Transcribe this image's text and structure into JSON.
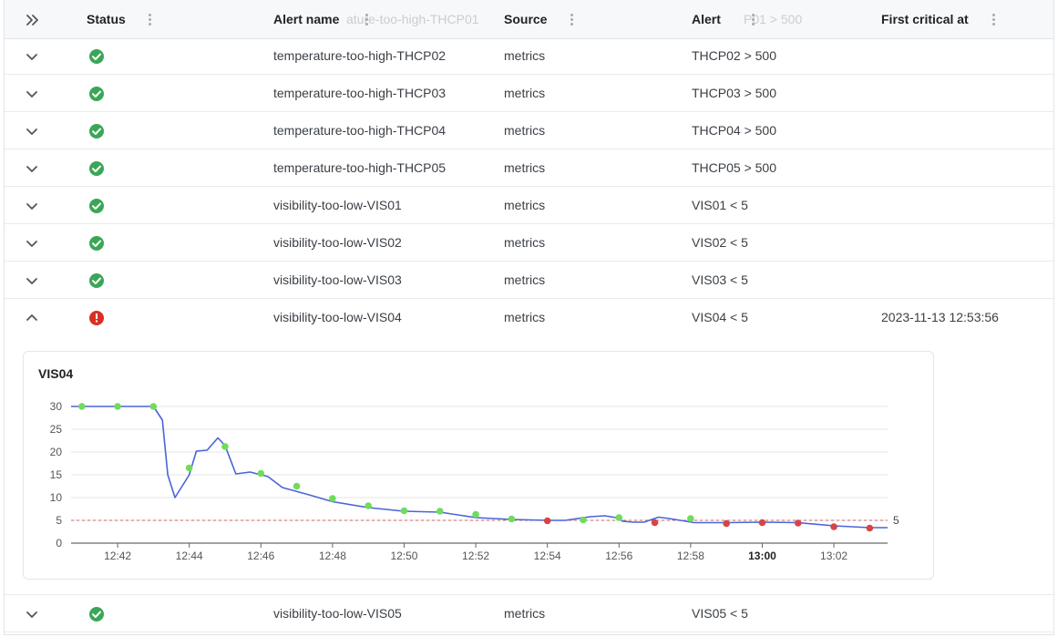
{
  "columns": {
    "status": "Status",
    "alert_name": "Alert name",
    "source": "Source",
    "alert": "Alert",
    "first_critical_at": "First critical at"
  },
  "ghost_header": {
    "alert_name": "ature-too-high-THCP01",
    "alert": "P01 > 500"
  },
  "rows": [
    {
      "name": "temperature-too-high-THCP02",
      "source": "metrics",
      "alert": "THCP02 > 500",
      "status": "ok",
      "first_critical": "",
      "expanded": false
    },
    {
      "name": "temperature-too-high-THCP03",
      "source": "metrics",
      "alert": "THCP03 > 500",
      "status": "ok",
      "first_critical": "",
      "expanded": false
    },
    {
      "name": "temperature-too-high-THCP04",
      "source": "metrics",
      "alert": "THCP04 > 500",
      "status": "ok",
      "first_critical": "",
      "expanded": false
    },
    {
      "name": "temperature-too-high-THCP05",
      "source": "metrics",
      "alert": "THCP05 > 500",
      "status": "ok",
      "first_critical": "",
      "expanded": false
    },
    {
      "name": "visibility-too-low-VIS01",
      "source": "metrics",
      "alert": "VIS01 < 5",
      "status": "ok",
      "first_critical": "",
      "expanded": false
    },
    {
      "name": "visibility-too-low-VIS02",
      "source": "metrics",
      "alert": "VIS02 < 5",
      "status": "ok",
      "first_critical": "",
      "expanded": false
    },
    {
      "name": "visibility-too-low-VIS03",
      "source": "metrics",
      "alert": "VIS03 < 5",
      "status": "ok",
      "first_critical": "",
      "expanded": false
    },
    {
      "name": "visibility-too-low-VIS04",
      "source": "metrics",
      "alert": "VIS04 < 5",
      "status": "critical",
      "first_critical": "2023-11-13 12:53:56",
      "expanded": true
    },
    {
      "name": "visibility-too-low-VIS05",
      "source": "metrics",
      "alert": "VIS05 < 5",
      "status": "ok",
      "first_critical": "",
      "expanded": false
    }
  ],
  "colors": {
    "ok": "#3aa757",
    "critical": "#d93025",
    "line": "#4a64d8",
    "ok_point": "#6fdc5c",
    "critical_point": "#d64545",
    "threshold": "#d06060"
  },
  "chart_data": {
    "type": "line",
    "title": "VIS04",
    "ylim": [
      0,
      30
    ],
    "yticks": [
      0,
      5,
      10,
      15,
      20,
      25,
      30
    ],
    "xlim_minutes": [
      40.7,
      63.5
    ],
    "xticks": [
      {
        "label": "12:42",
        "m": 42,
        "bold": false
      },
      {
        "label": "12:44",
        "m": 44,
        "bold": false
      },
      {
        "label": "12:46",
        "m": 46,
        "bold": false
      },
      {
        "label": "12:48",
        "m": 48,
        "bold": false
      },
      {
        "label": "12:50",
        "m": 50,
        "bold": false
      },
      {
        "label": "12:52",
        "m": 52,
        "bold": false
      },
      {
        "label": "12:54",
        "m": 54,
        "bold": false
      },
      {
        "label": "12:56",
        "m": 56,
        "bold": false
      },
      {
        "label": "12:58",
        "m": 58,
        "bold": false
      },
      {
        "label": "13:00",
        "m": 60,
        "bold": true
      },
      {
        "label": "13:02",
        "m": 62,
        "bold": false
      }
    ],
    "threshold": {
      "value": 5,
      "label": "5"
    },
    "line": [
      [
        40.7,
        30
      ],
      [
        43.0,
        30
      ],
      [
        43.25,
        27
      ],
      [
        43.4,
        15
      ],
      [
        43.6,
        10
      ],
      [
        44.0,
        15
      ],
      [
        44.2,
        20.2
      ],
      [
        44.5,
        20.4
      ],
      [
        44.8,
        23.1
      ],
      [
        45.0,
        21.4
      ],
      [
        45.3,
        15.2
      ],
      [
        45.7,
        15.6
      ],
      [
        46.2,
        14.6
      ],
      [
        46.6,
        12.2
      ],
      [
        47.3,
        10.7
      ],
      [
        48.0,
        9.1
      ],
      [
        49.0,
        7.8
      ],
      [
        50.0,
        7.0
      ],
      [
        51.0,
        6.8
      ],
      [
        52.0,
        5.6
      ],
      [
        53.0,
        5.2
      ],
      [
        54.0,
        5.0
      ],
      [
        54.5,
        5.0
      ],
      [
        55.2,
        5.8
      ],
      [
        55.6,
        6.0
      ],
      [
        56.0,
        5.5
      ],
      [
        56.1,
        4.8
      ],
      [
        56.4,
        4.6
      ],
      [
        56.7,
        4.6
      ],
      [
        57.1,
        5.7
      ],
      [
        57.4,
        5.4
      ],
      [
        58.1,
        4.5
      ],
      [
        59.0,
        4.5
      ],
      [
        60.0,
        4.6
      ],
      [
        61.0,
        4.5
      ],
      [
        62.0,
        3.8
      ],
      [
        63.0,
        3.4
      ],
      [
        63.5,
        3.4
      ]
    ],
    "points": [
      {
        "m": 41,
        "v": 30,
        "s": "ok"
      },
      {
        "m": 42,
        "v": 30,
        "s": "ok"
      },
      {
        "m": 43,
        "v": 30,
        "s": "ok"
      },
      {
        "m": 44,
        "v": 16.5,
        "s": "ok"
      },
      {
        "m": 45,
        "v": 21.2,
        "s": "ok"
      },
      {
        "m": 46,
        "v": 15.3,
        "s": "ok"
      },
      {
        "m": 47,
        "v": 12.5,
        "s": "ok"
      },
      {
        "m": 48,
        "v": 9.8,
        "s": "ok"
      },
      {
        "m": 49,
        "v": 8.2,
        "s": "ok"
      },
      {
        "m": 50,
        "v": 7.1,
        "s": "ok"
      },
      {
        "m": 51,
        "v": 7.0,
        "s": "ok"
      },
      {
        "m": 52,
        "v": 6.3,
        "s": "ok"
      },
      {
        "m": 53,
        "v": 5.3,
        "s": "ok"
      },
      {
        "m": 54,
        "v": 4.9,
        "s": "critical"
      },
      {
        "m": 55,
        "v": 5.1,
        "s": "ok"
      },
      {
        "m": 56,
        "v": 5.6,
        "s": "ok"
      },
      {
        "m": 57,
        "v": 4.5,
        "s": "critical"
      },
      {
        "m": 58,
        "v": 5.4,
        "s": "ok"
      },
      {
        "m": 59,
        "v": 4.3,
        "s": "critical"
      },
      {
        "m": 60,
        "v": 4.5,
        "s": "critical"
      },
      {
        "m": 61,
        "v": 4.4,
        "s": "critical"
      },
      {
        "m": 62,
        "v": 3.6,
        "s": "critical"
      },
      {
        "m": 63,
        "v": 3.3,
        "s": "critical"
      }
    ]
  }
}
